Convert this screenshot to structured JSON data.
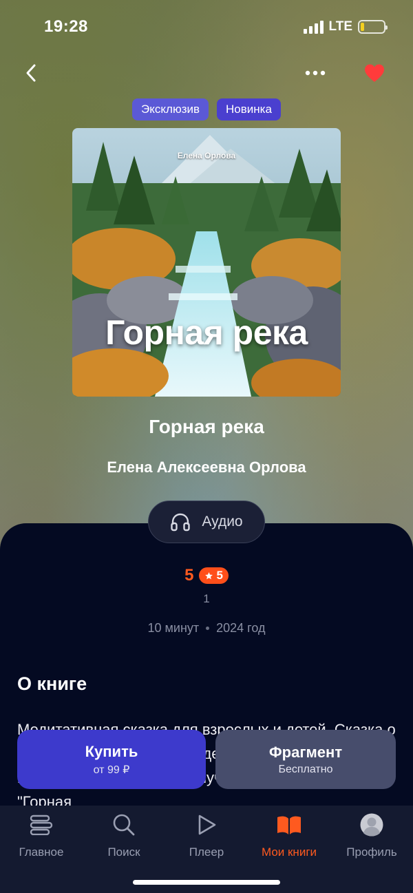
{
  "status_bar": {
    "time": "19:28",
    "network": "LTE"
  },
  "badges": [
    {
      "label": "Эксклюзив"
    },
    {
      "label": "Новинка"
    }
  ],
  "cover": {
    "author": "Елена Орлова",
    "title": "Горная река"
  },
  "book": {
    "title": "Горная река",
    "author": "Елена Алексеевна Орлова"
  },
  "format": {
    "label": "Аудио",
    "icon": "headphones-icon"
  },
  "rating": {
    "value": "5",
    "badge": "5",
    "count": "1"
  },
  "meta": {
    "duration": "10 минут",
    "year": "2024 год"
  },
  "about": {
    "title": "О книге",
    "text": "Медитативная сказка для взрослых и детей. Сказка о гармонии, которая учит видеть красоту природы, направленная на благополучие и развитие. В сказке \"Горная"
  },
  "actions": {
    "buy": {
      "label": "Купить",
      "sub": "от 99 ₽"
    },
    "fragment": {
      "label": "Фрагмент",
      "sub": "Бесплатно"
    }
  },
  "tabs": [
    {
      "label": "Главное",
      "icon": "stack-icon"
    },
    {
      "label": "Поиск",
      "icon": "search-icon"
    },
    {
      "label": "Плеер",
      "icon": "play-icon"
    },
    {
      "label": "Мои книги",
      "icon": "open-book-icon"
    },
    {
      "label": "Профиль",
      "icon": "avatar-icon"
    }
  ],
  "colors": {
    "accent": "#ff5a1f",
    "primary_button": "#3d3acc",
    "secondary_button": "#474d6c",
    "panel": "#040a22",
    "favorite": "#ff3b3b"
  }
}
